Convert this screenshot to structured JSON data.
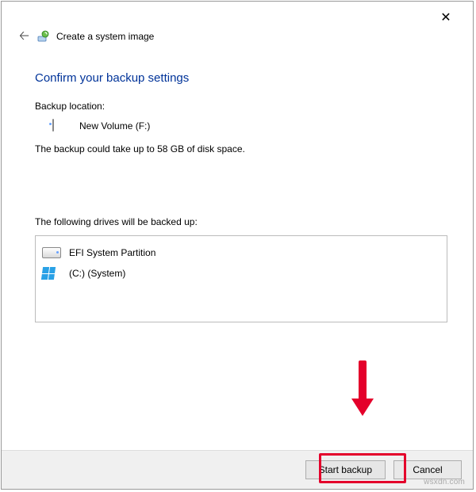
{
  "window": {
    "title": "Create a system image"
  },
  "heading": "Confirm your backup settings",
  "backup": {
    "location_label": "Backup location:",
    "location_value": "New Volume (F:)",
    "size_line": "The backup could take up to 58 GB of disk space."
  },
  "drives_section": {
    "label": "The following drives will be backed up:",
    "items": [
      {
        "label": "EFI System Partition",
        "icon": "drive-icon"
      },
      {
        "label": "(C:) (System)",
        "icon": "windows-drive-icon"
      }
    ]
  },
  "buttons": {
    "start": "Start backup",
    "cancel": "Cancel"
  },
  "watermark": "wsxdn.com"
}
